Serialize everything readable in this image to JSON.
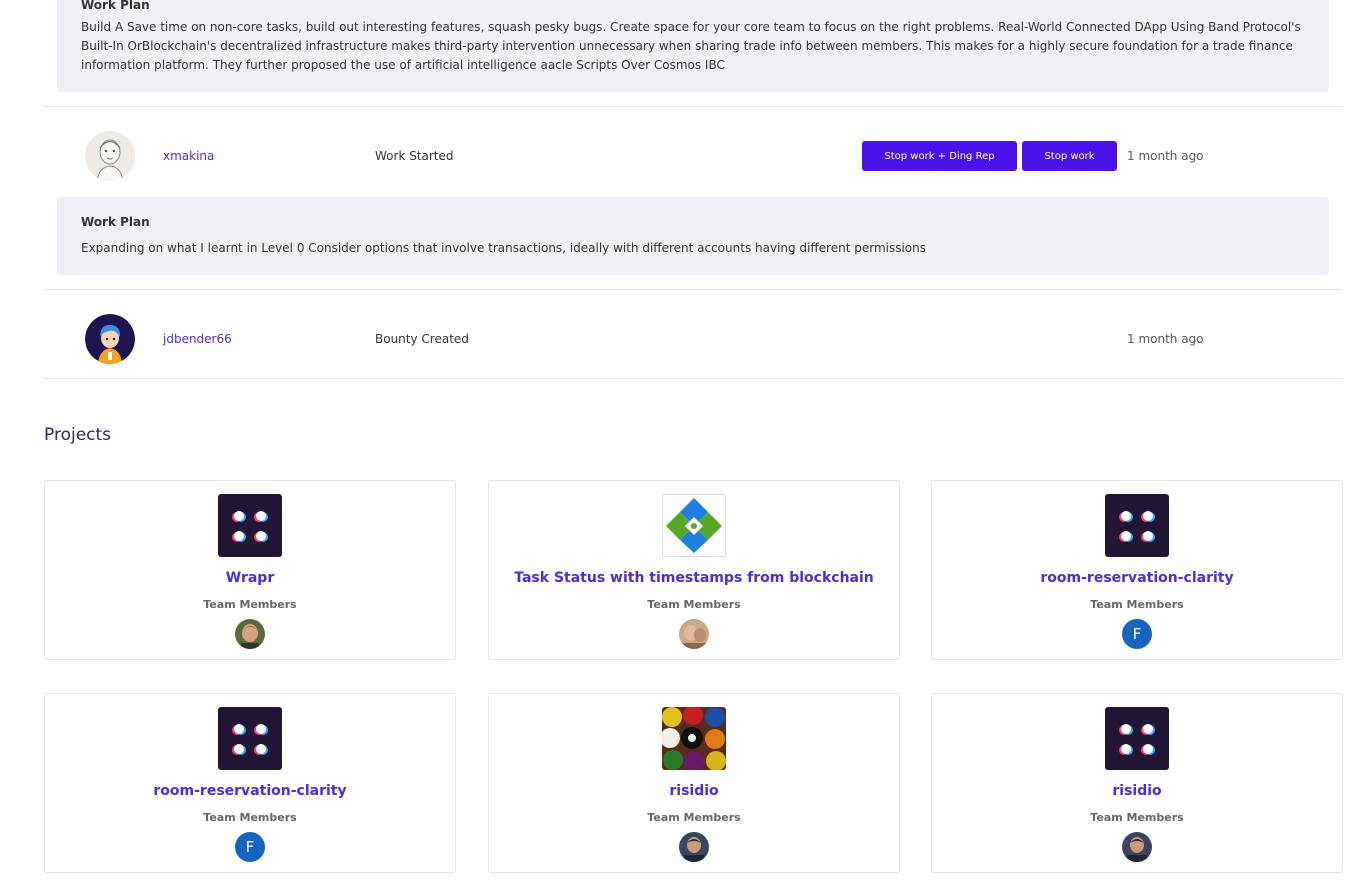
{
  "activity": [
    {
      "work_plan_title": "Work Plan",
      "work_plan_text": "Build A Save time on non-core tasks, build out interesting features, squash pesky bugs. Create space for your core team to focus on the right problems. Real-World Connected DApp Using Band Protocol's Built-In OrBlockchain's decentralized infrastructure makes third-party intervention unnecessary when sharing trade info between members. This makes for a highly secure foundation for a trade finance information platform. They further proposed the use of artificial intelligence aacle Scripts Over Cosmos IBC"
    },
    {
      "username": "xmakina",
      "status": "Work Started",
      "stop_ding_label": "Stop work + Ding Rep",
      "stop_label": "Stop work",
      "time": "1 month ago",
      "work_plan_title": "Work Plan",
      "work_plan_text": "Expanding on what I learnt in Level 0 Consider options that involve transactions, ideally with different accounts having different permissions"
    },
    {
      "username": "jdbender66",
      "status": "Bounty Created",
      "time": "1 month ago"
    }
  ],
  "projects_title": "Projects",
  "projects": [
    {
      "name": "Wrapr",
      "team_label": "Team Members",
      "logo": "dots-logo",
      "member": "photo-avatar"
    },
    {
      "name": "Task Status with timestamps from blockchain",
      "team_label": "Team Members",
      "logo": "green-blue-diamond-logo",
      "member": "photo-avatar"
    },
    {
      "name": "room-reservation-clarity",
      "team_label": "Team Members",
      "logo": "dots-logo",
      "member": "F"
    },
    {
      "name": "room-reservation-clarity",
      "team_label": "Team Members",
      "logo": "dots-logo",
      "member": "F"
    },
    {
      "name": "risidio",
      "team_label": "Team Members",
      "logo": "billiard-balls-logo",
      "member": "photo-avatar"
    },
    {
      "name": "risidio",
      "team_label": "Team Members",
      "logo": "dots-logo",
      "member": "photo-avatar"
    }
  ],
  "colors": {
    "accent": "#4c2be0",
    "button": "#4a12e8",
    "workplan_bg": "#eef0f4"
  }
}
